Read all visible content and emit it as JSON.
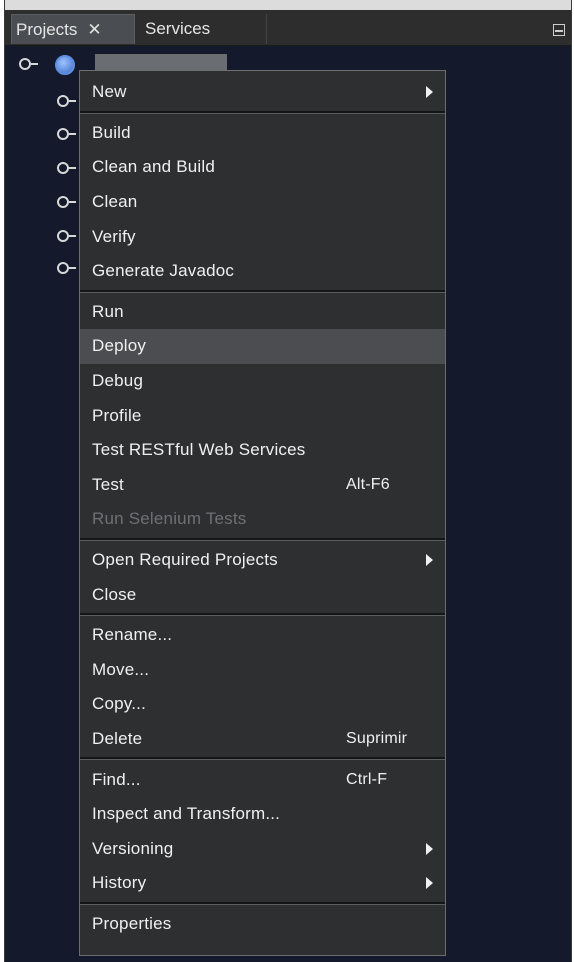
{
  "tabs": {
    "projects_label": "Projects",
    "projects_close": "✕",
    "services_label": "Services"
  },
  "tree": {
    "root_icon": "globe-icon",
    "child_icon": "node-connector-icon"
  },
  "menu": {
    "items": [
      {
        "label": "New",
        "accel": "",
        "submenu": true
      },
      {
        "label": "Build",
        "accel": "",
        "submenu": false
      },
      {
        "label": "Clean and Build",
        "accel": "",
        "submenu": false
      },
      {
        "label": "Clean",
        "accel": "",
        "submenu": false
      },
      {
        "label": "Verify",
        "accel": "",
        "submenu": false
      },
      {
        "label": "Generate Javadoc",
        "accel": "",
        "submenu": false
      },
      {
        "label": "Run",
        "accel": "",
        "submenu": false
      },
      {
        "label": "Deploy",
        "accel": "",
        "submenu": false,
        "highlighted": true
      },
      {
        "label": "Debug",
        "accel": "",
        "submenu": false
      },
      {
        "label": "Profile",
        "accel": "",
        "submenu": false
      },
      {
        "label": "Test RESTful Web Services",
        "accel": "",
        "submenu": false
      },
      {
        "label": "Test",
        "accel": "Alt-F6",
        "submenu": false
      },
      {
        "label": "Run Selenium Tests",
        "accel": "",
        "submenu": false,
        "disabled": true
      },
      {
        "label": "Open Required Projects",
        "accel": "",
        "submenu": true
      },
      {
        "label": "Close",
        "accel": "",
        "submenu": false
      },
      {
        "label": "Rename...",
        "accel": "",
        "submenu": false
      },
      {
        "label": "Move...",
        "accel": "",
        "submenu": false
      },
      {
        "label": "Copy...",
        "accel": "",
        "submenu": false
      },
      {
        "label": "Delete",
        "accel": "Suprimir",
        "submenu": false
      },
      {
        "label": "Find...",
        "accel": "Ctrl-F",
        "submenu": false
      },
      {
        "label": "Inspect and Transform...",
        "accel": "",
        "submenu": false
      },
      {
        "label": "Versioning",
        "accel": "",
        "submenu": true
      },
      {
        "label": "History",
        "accel": "",
        "submenu": true
      },
      {
        "label": "Properties",
        "accel": "",
        "submenu": false
      }
    ]
  },
  "colors": {
    "panel_bg": "#141a2c",
    "menu_bg": "#2e2f31",
    "highlight_bg": "#4b4d51",
    "text": "#f0f0f0",
    "disabled_text": "#6e7075"
  }
}
